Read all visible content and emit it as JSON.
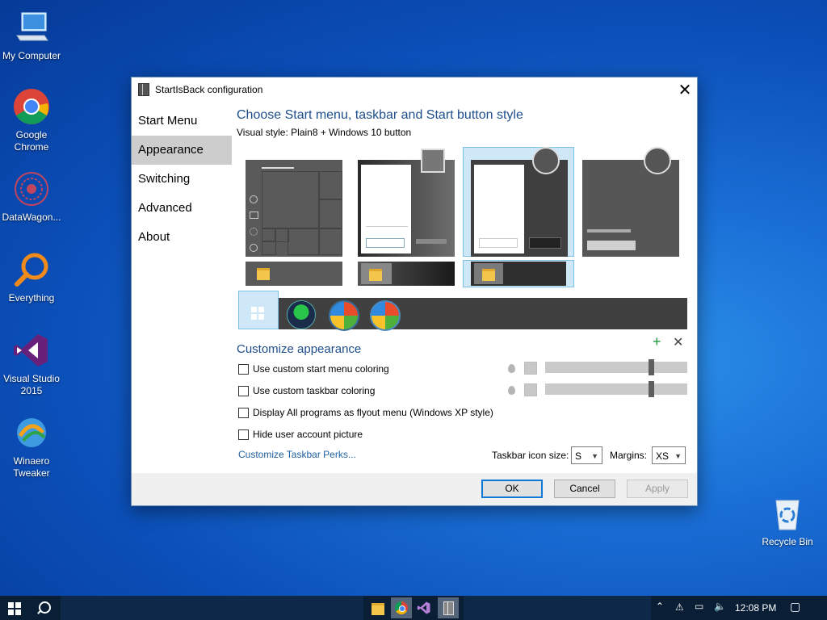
{
  "desktop": {
    "icons": [
      {
        "label": "My Computer",
        "icon": "computer-icon"
      },
      {
        "label": "Google Chrome",
        "icon": "chrome-icon"
      },
      {
        "label": "DataWagon...",
        "icon": "datawagon-icon"
      },
      {
        "label": "Everything",
        "icon": "search-magnifier-icon"
      },
      {
        "label": "Visual Studio 2015",
        "icon": "visual-studio-icon"
      },
      {
        "label": "Winaero Tweaker",
        "icon": "winaero-icon"
      },
      {
        "label": "Recycle Bin",
        "icon": "recycle-bin-icon"
      }
    ]
  },
  "dialog": {
    "title": "StartIsBack configuration",
    "nav": [
      "Start Menu",
      "Appearance",
      "Switching",
      "Advanced",
      "About"
    ],
    "active_nav": "Appearance",
    "heading": "Choose Start menu, taskbar and Start button style",
    "visual_style": "Visual style:  Plain8 + Windows 10 button",
    "selected_style_index": 2,
    "customize_heading": "Customize appearance",
    "options": [
      {
        "label": "Use custom start menu coloring",
        "checked": false
      },
      {
        "label": "Use custom taskbar coloring",
        "checked": false
      },
      {
        "label": "Display All programs as flyout menu (Windows XP style)",
        "checked": false
      },
      {
        "label": "Hide user account picture",
        "checked": false
      }
    ],
    "sliders": [
      {
        "value_pct": 75
      },
      {
        "value_pct": 75
      }
    ],
    "link": "Customize Taskbar Perks...",
    "taskbar_icon_size_label": "Taskbar icon size:",
    "taskbar_icon_size_value": "S",
    "margins_label": "Margins:",
    "margins_value": "XS",
    "buttons": {
      "ok": "OK",
      "cancel": "Cancel",
      "apply": "Apply"
    }
  },
  "taskbar": {
    "clock": "12:08 PM",
    "pinned": [
      "file-explorer-icon",
      "chrome-icon",
      "visual-studio-icon",
      "startisback-icon"
    ]
  },
  "colors": {
    "accent": "#1e4e8c",
    "desktop": "#0b4fb8",
    "taskbar": "#0d2849",
    "selection": "#cfe8f7"
  }
}
